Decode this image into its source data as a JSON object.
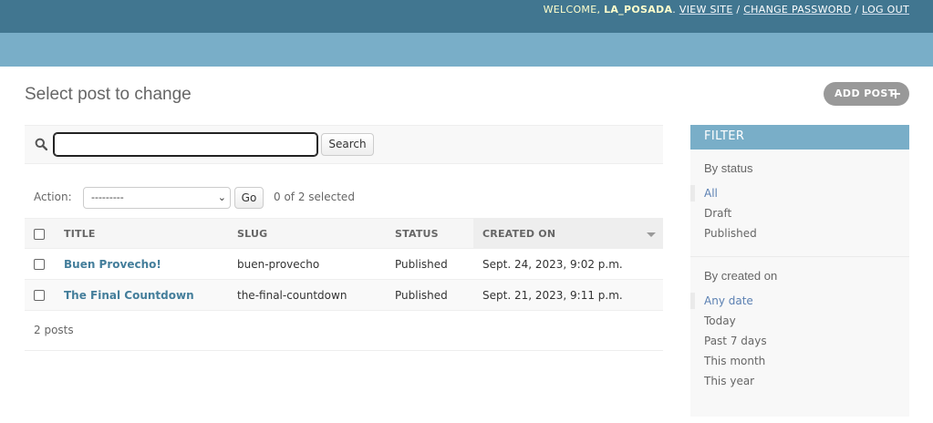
{
  "header": {
    "welcome": "WELCOME,",
    "username": "LA_POSADA",
    "links": [
      "VIEW SITE",
      "CHANGE PASSWORD",
      "LOG OUT"
    ]
  },
  "page": {
    "title": "Select post to change",
    "add_button": "ADD POST",
    "add_icon": "plus-icon"
  },
  "search": {
    "icon": "search-icon",
    "value": "",
    "button": "Search"
  },
  "actions": {
    "label": "Action:",
    "selected_option": "---------",
    "go_button": "Go",
    "selection_count": "0 of 2 selected"
  },
  "table": {
    "columns": [
      "TITLE",
      "SLUG",
      "STATUS",
      "CREATED ON"
    ],
    "sorted_column": "CREATED ON",
    "rows": [
      {
        "title": "Buen Provecho!",
        "slug": "buen-provecho",
        "status": "Published",
        "created_on": "Sept. 24, 2023, 9:02 p.m."
      },
      {
        "title": "The Final Countdown",
        "slug": "the-final-countdown",
        "status": "Published",
        "created_on": "Sept. 21, 2023, 9:11 p.m."
      }
    ]
  },
  "paginator": {
    "text": "2 posts"
  },
  "filter": {
    "title": "FILTER",
    "sections": [
      {
        "heading": "By status",
        "options": [
          "All",
          "Draft",
          "Published"
        ],
        "selected": "All"
      },
      {
        "heading": "By created on",
        "options": [
          "Any date",
          "Today",
          "Past 7 days",
          "This month",
          "This year"
        ],
        "selected": "Any date"
      }
    ]
  },
  "colors": {
    "header_bg": "#417690",
    "breadcrumb_bg": "#79aec8",
    "link": "#447e9b"
  }
}
